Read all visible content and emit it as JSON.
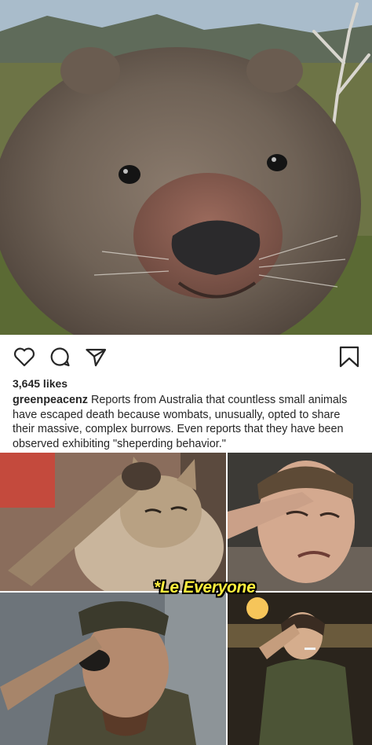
{
  "post": {
    "image_alt": "close-up wombat photo",
    "likes": "3,645 likes",
    "username": "greenpeacenz",
    "caption_text": " Reports from Australia that countless small animals have escaped death because wombats, unusually, opted to share their massive, complex burrows. Even reports that they have been observed exhibiting \"sheperding behavior.\""
  },
  "actions": {
    "icons": [
      "heart-icon",
      "comment-icon",
      "share-icon",
      "bookmark-icon"
    ]
  },
  "meme": {
    "caption": "*Le Everyone",
    "caption_color": "#ffef3d",
    "tiles": [
      "saluting-cat",
      "crying-man-salute",
      "soldier-salute",
      "smoking-man-salute"
    ]
  }
}
